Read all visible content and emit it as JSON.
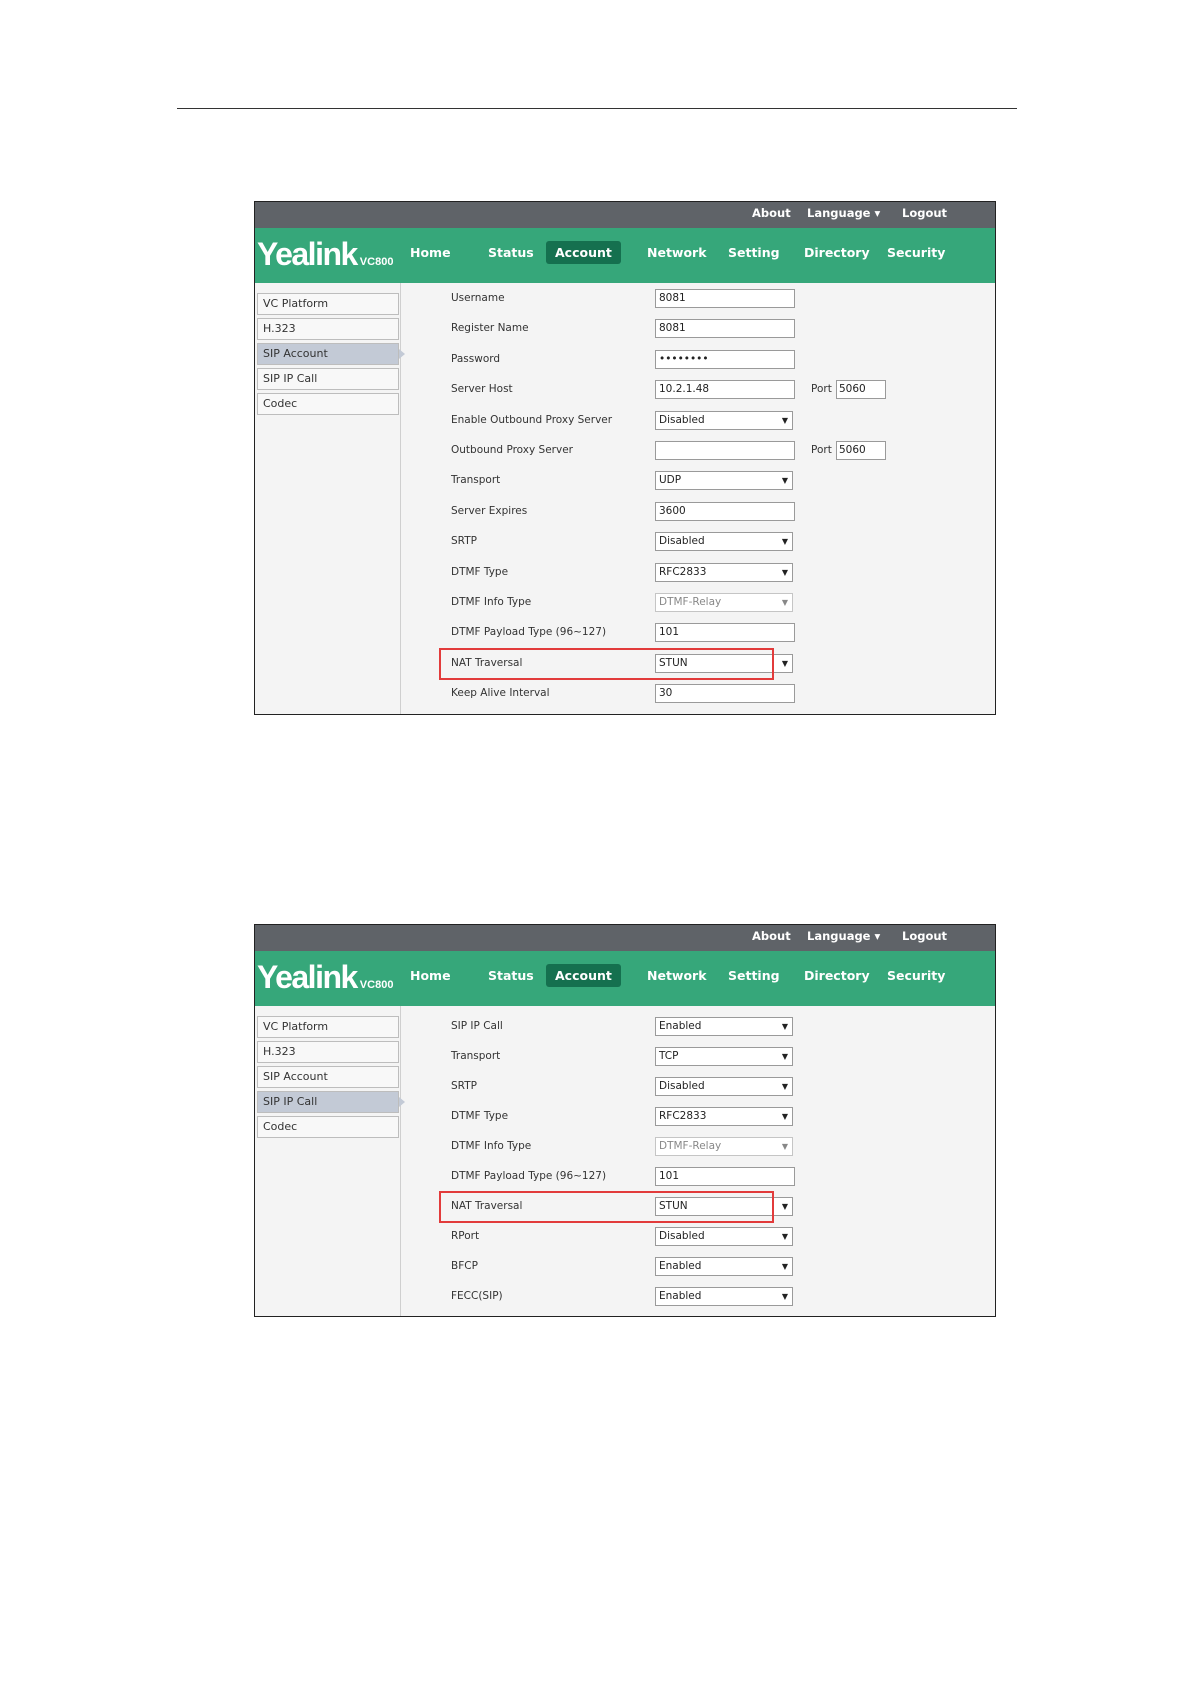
{
  "topbar": {
    "about": "About",
    "language": "Language ▾",
    "logout": "Logout"
  },
  "logo": {
    "brand": "Yealink",
    "model": "VC800"
  },
  "nav": [
    "Home",
    "Status",
    "Account",
    "Network",
    "Setting",
    "Directory",
    "Security"
  ],
  "nav_active": "Account",
  "sidebar": [
    "VC Platform",
    "H.323",
    "SIP Account",
    "SIP IP Call",
    "Codec"
  ],
  "shot1": {
    "active_sidebar": "SIP Account",
    "rows": [
      {
        "label": "Username",
        "value": "8081",
        "kind": "input"
      },
      {
        "label": "Register Name",
        "value": "8081",
        "kind": "input"
      },
      {
        "label": "Password",
        "value": "••••••••",
        "kind": "input"
      },
      {
        "label": "Server Host",
        "value": "10.2.1.48",
        "kind": "input",
        "port_label": "Port",
        "port": "5060"
      },
      {
        "label": "Enable Outbound Proxy Server",
        "value": "Disabled",
        "kind": "select"
      },
      {
        "label": "Outbound Proxy Server",
        "value": "",
        "kind": "input",
        "port_label": "Port",
        "port": "5060"
      },
      {
        "label": "Transport",
        "value": "UDP",
        "kind": "select"
      },
      {
        "label": "Server Expires",
        "value": "3600",
        "kind": "input"
      },
      {
        "label": "SRTP",
        "value": "Disabled",
        "kind": "select"
      },
      {
        "label": "DTMF Type",
        "value": "RFC2833",
        "kind": "select"
      },
      {
        "label": "DTMF Info Type",
        "value": "DTMF-Relay",
        "kind": "select",
        "disabled": true
      },
      {
        "label": "DTMF Payload Type (96~127)",
        "value": "101",
        "kind": "input"
      },
      {
        "label": "NAT Traversal",
        "value": "STUN",
        "kind": "select",
        "highlight": true
      },
      {
        "label": "Keep Alive Interval",
        "value": "30",
        "kind": "input"
      }
    ]
  },
  "shot2": {
    "active_sidebar": "SIP IP Call",
    "rows": [
      {
        "label": "SIP IP Call",
        "value": "Enabled",
        "kind": "select"
      },
      {
        "label": "Transport",
        "value": "TCP",
        "kind": "select"
      },
      {
        "label": "SRTP",
        "value": "Disabled",
        "kind": "select"
      },
      {
        "label": "DTMF Type",
        "value": "RFC2833",
        "kind": "select"
      },
      {
        "label": "DTMF Info Type",
        "value": "DTMF-Relay",
        "kind": "select",
        "disabled": true
      },
      {
        "label": "DTMF Payload Type (96~127)",
        "value": "101",
        "kind": "input"
      },
      {
        "label": "NAT Traversal",
        "value": "STUN",
        "kind": "select",
        "highlight": true
      },
      {
        "label": "RPort",
        "value": "Disabled",
        "kind": "select"
      },
      {
        "label": "BFCP",
        "value": "Enabled",
        "kind": "select"
      },
      {
        "label": "FECC(SIP)",
        "value": "Enabled",
        "kind": "select"
      }
    ]
  },
  "colors": {
    "nav_green": "#36a77a",
    "active_tab": "#15704f",
    "topbar": "#5f6368",
    "highlight": "#e23b3b"
  }
}
